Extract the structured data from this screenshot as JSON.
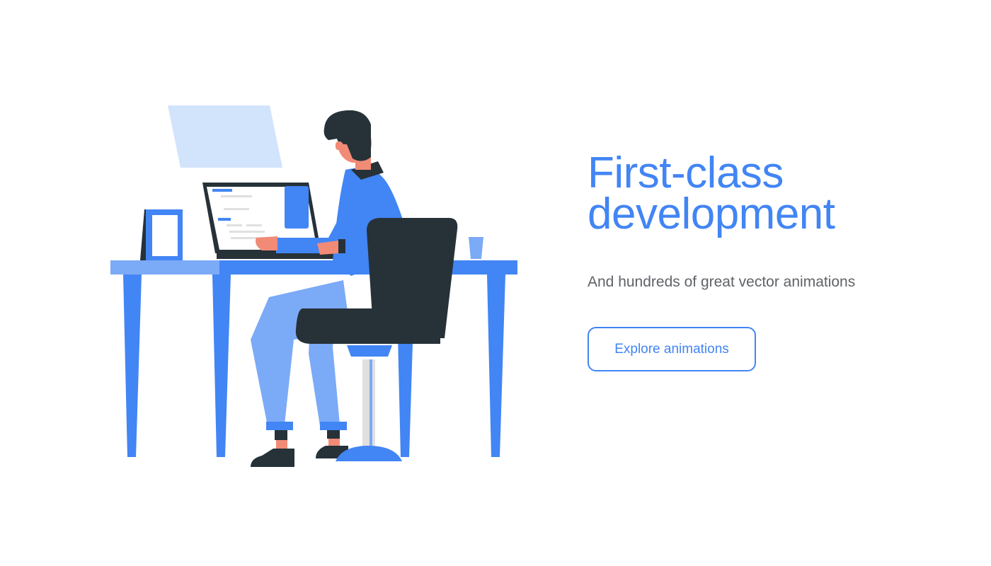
{
  "hero": {
    "title_line1": "First-class",
    "title_line2": "development",
    "subtitle": "And hundreds of great vector animations",
    "cta_label": "Explore animations"
  },
  "colors": {
    "accent": "#4285f4",
    "accent_light": "#7baaf7",
    "panel_light": "#d2e3fc",
    "dark": "#263238",
    "skin": "#f28b76",
    "text_muted": "#5f6368",
    "background": "#ffffff"
  }
}
